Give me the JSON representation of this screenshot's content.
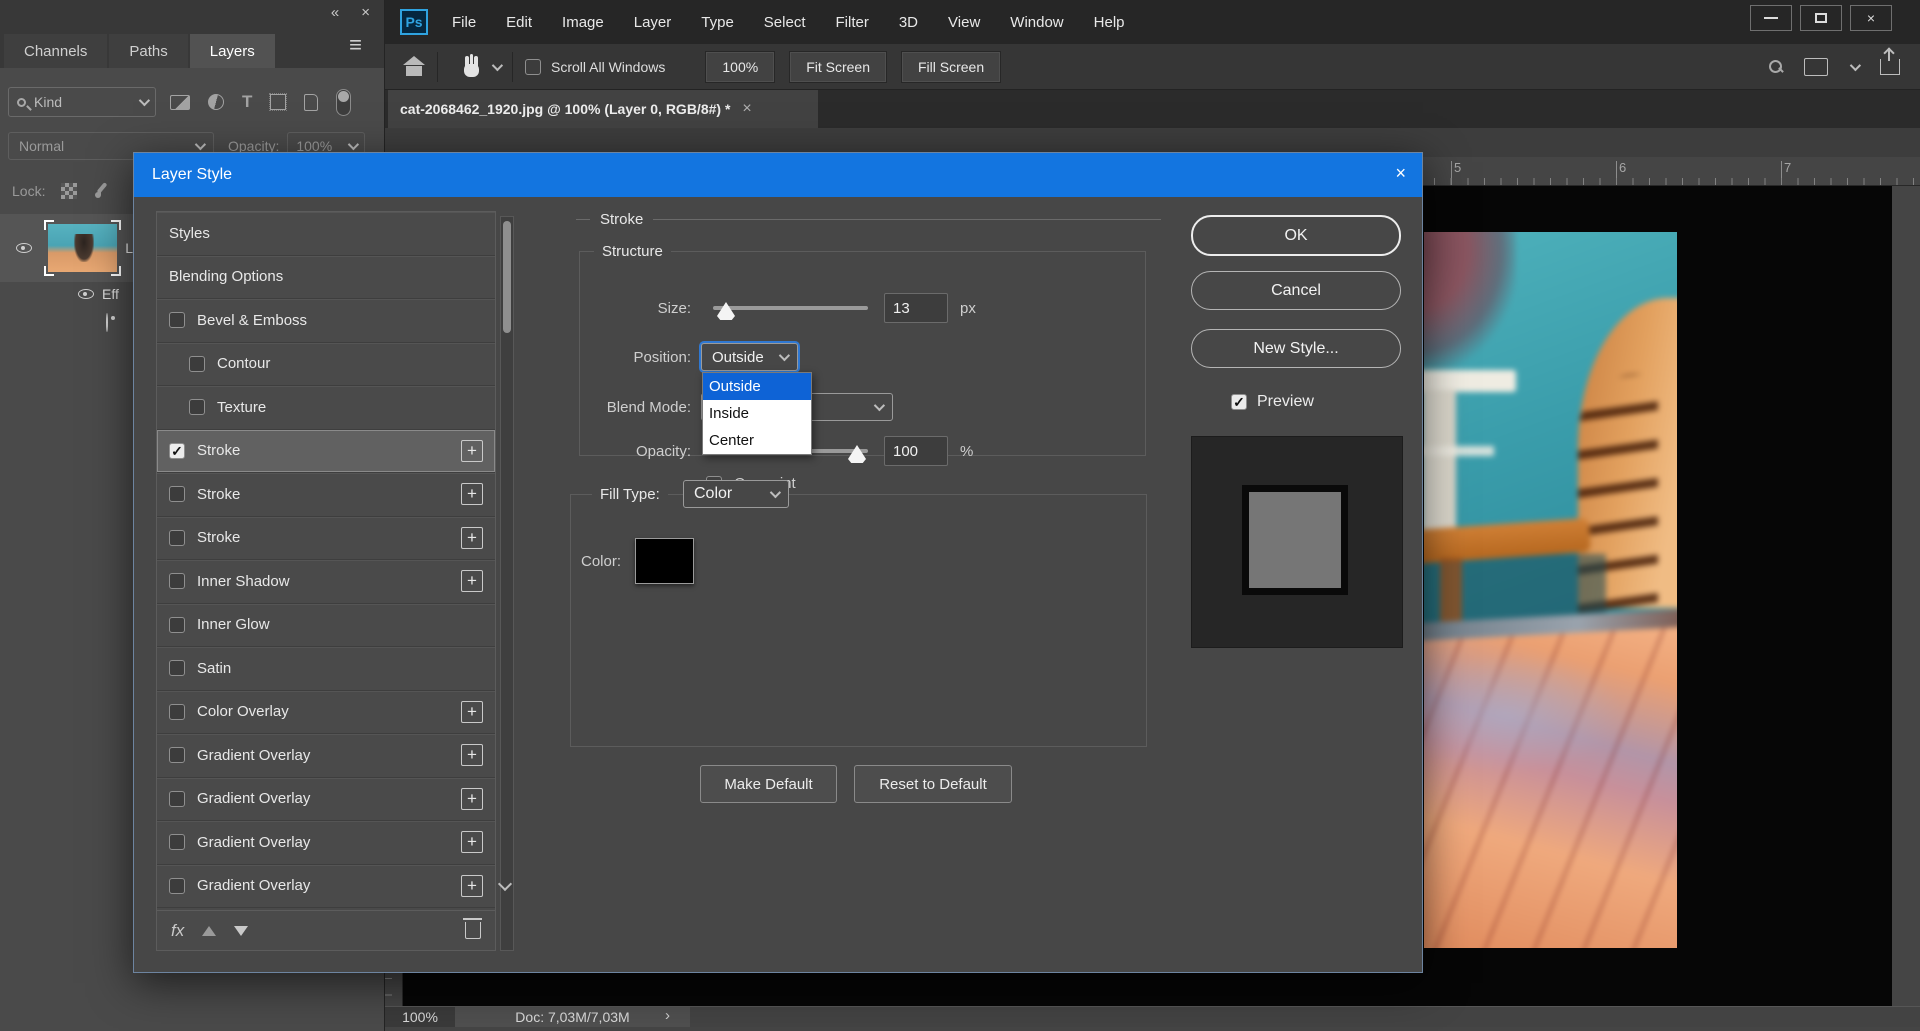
{
  "app": {
    "logo_text": "Ps",
    "menu": [
      "File",
      "Edit",
      "Image",
      "Layer",
      "Type",
      "Select",
      "Filter",
      "3D",
      "View",
      "Window",
      "Help"
    ],
    "window_close": "×"
  },
  "options_bar": {
    "scroll_all_windows": "Scroll All Windows",
    "zoom_btn": "100%",
    "fit_screen": "Fit Screen",
    "fill_screen": "Fill Screen"
  },
  "left_panel": {
    "collapse_glyph": "«",
    "close_glyph": "×",
    "hamburger_glyph": "≡",
    "tabs": [
      "Channels",
      "Paths",
      "Layers"
    ],
    "kind_label": "Kind",
    "blend_mode_value": "Normal",
    "opacity_label": "Opacity:",
    "opacity_value": "100%",
    "lock_label": "Lock:",
    "layer_name_partial": "L",
    "effects_partial": "Eff"
  },
  "doc": {
    "tab_title": "cat-2068462_1920.jpg @ 100% (Layer 0, RGB/8#) *",
    "tab_close": "×",
    "ruler_numbers": [
      "5",
      "6",
      "7"
    ],
    "status_zoom": "100%",
    "status_doc": "Doc: 7,03M/7,03M",
    "status_chevron": "›"
  },
  "dialog": {
    "title": "Layer Style",
    "close_glyph": "×",
    "check_glyph": "✓",
    "list": [
      {
        "label": "Styles"
      },
      {
        "label": "Blending Options"
      },
      {
        "label": "Bevel & Emboss"
      },
      {
        "label": "Contour"
      },
      {
        "label": "Texture"
      },
      {
        "label": "Stroke"
      },
      {
        "label": "Stroke"
      },
      {
        "label": "Stroke"
      },
      {
        "label": "Inner Shadow"
      },
      {
        "label": "Inner Glow"
      },
      {
        "label": "Satin"
      },
      {
        "label": "Color Overlay"
      },
      {
        "label": "Gradient Overlay"
      },
      {
        "label": "Gradient Overlay"
      },
      {
        "label": "Gradient Overlay"
      },
      {
        "label": "Gradient Overlay"
      }
    ],
    "plus_glyph": "+",
    "fx_label": "fx",
    "stroke_panel": {
      "title": "Stroke",
      "group_label": "Structure",
      "size_label": "Size:",
      "size_value": "13",
      "size_unit": "px",
      "position_label": "Position:",
      "position_value": "Outside",
      "blend_mode_label": "Blend Mode:",
      "opacity_label": "Opacity:",
      "opacity_value": "100",
      "opacity_unit": "%",
      "overprint_label": "Overprint",
      "fill_type_label": "Fill Type:",
      "fill_type_value": "Color",
      "color_label": "Color:",
      "make_default": "Make Default",
      "reset_default": "Reset to Default"
    },
    "position_menu": [
      "Outside",
      "Inside",
      "Center"
    ],
    "position_menu_selected": "Outside",
    "buttons": {
      "ok": "OK",
      "cancel": "Cancel",
      "new_style": "New Style...",
      "preview": "Preview"
    }
  },
  "colors": {
    "accent_blue": "#1375e0",
    "menu_highlight": "#0e63d6",
    "stroke_color_swatch": "#000000"
  }
}
